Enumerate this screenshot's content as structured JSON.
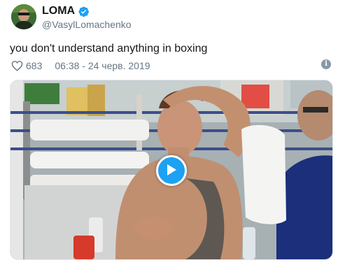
{
  "account": {
    "display_name": "LOMA",
    "handle": "@VasylLomachenko",
    "verified": true
  },
  "tweet": {
    "text": "you don't understand anything in boxing",
    "likes": "683",
    "timestamp": "06:38 - 24 черв. 2019"
  },
  "icons": {
    "verified": "verified-badge-icon",
    "like": "heart-icon",
    "info": "info-icon",
    "play": "play-icon"
  },
  "colors": {
    "accent": "#1da1f2",
    "text": "#14171a",
    "secondary_text": "#657786"
  }
}
